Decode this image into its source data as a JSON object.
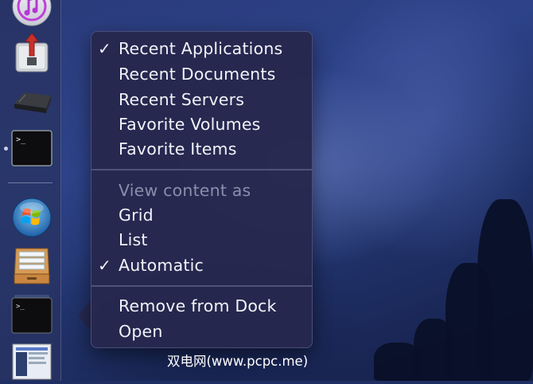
{
  "dock": {
    "icons": [
      {
        "name": "itunes-icon"
      },
      {
        "name": "archive-utility-icon"
      },
      {
        "name": "ps3-console-icon"
      },
      {
        "name": "terminal-icon",
        "running": true
      },
      {
        "name": "windows-orb-icon"
      },
      {
        "name": "drawer-folder-icon"
      },
      {
        "name": "terminal-stack-icon"
      },
      {
        "name": "screenshot-thumbnail-icon"
      }
    ]
  },
  "menu": {
    "items": [
      {
        "label": "Recent Applications",
        "checked": true
      },
      {
        "label": "Recent Documents",
        "checked": false
      },
      {
        "label": "Recent Servers",
        "checked": false
      },
      {
        "label": "Favorite Volumes",
        "checked": false
      },
      {
        "label": "Favorite Items",
        "checked": false
      }
    ],
    "view_header": "View content as",
    "view_items": [
      {
        "label": "Grid",
        "checked": false
      },
      {
        "label": "List",
        "checked": false
      },
      {
        "label": "Automatic",
        "checked": true
      }
    ],
    "actions": [
      {
        "label": "Remove from Dock"
      },
      {
        "label": "Open"
      }
    ],
    "check_glyph": "✓"
  },
  "watermark": "双电网(www.pcpc.me)",
  "colors": {
    "menu_bg": "#26284e",
    "menu_text": "#f2f3f8",
    "disabled_text": "#8a8eab",
    "desktop_blue": "#2d4288"
  }
}
